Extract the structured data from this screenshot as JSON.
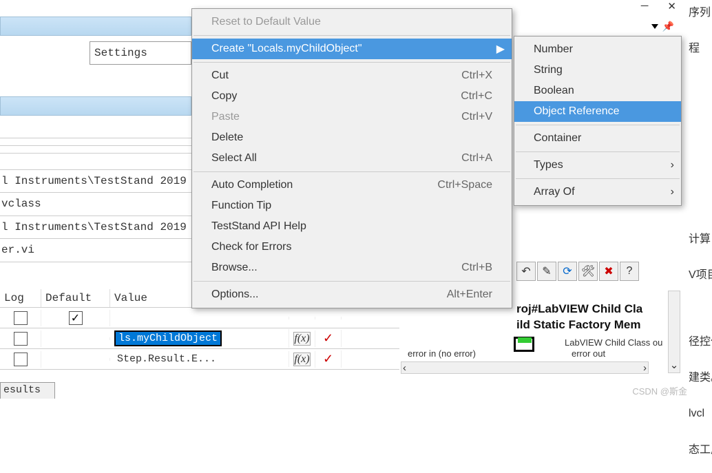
{
  "topbar": {
    "settings": "Settings"
  },
  "bg": {
    "row1": "l Instruments\\TestStand 2019",
    "row2": "vclass",
    "row3": "l Instruments\\TestStand 2019",
    "row4": "er.vi"
  },
  "table": {
    "hdr_log": "Log",
    "hdr_default": "Default",
    "hdr_value": "Value",
    "val1": "ls.myChildObject",
    "val2": "Step.Result.E...",
    "fx": "f(x)"
  },
  "results_tab": "esults",
  "menu": {
    "reset": "Reset to Default Value",
    "create": "Create \"Locals.myChildObject\"",
    "cut": "Cut",
    "cut_key": "Ctrl+X",
    "copy": "Copy",
    "copy_key": "Ctrl+C",
    "paste": "Paste",
    "paste_key": "Ctrl+V",
    "delete": "Delete",
    "selectall": "Select All",
    "selectall_key": "Ctrl+A",
    "auto": "Auto Completion",
    "auto_key": "Ctrl+Space",
    "ftip": "Function Tip",
    "api": "TestStand API Help",
    "check": "Check for Errors",
    "browse": "Browse...",
    "browse_key": "Ctrl+B",
    "options": "Options...",
    "options_key": "Alt+Enter"
  },
  "submenu": {
    "number": "Number",
    "string": "String",
    "boolean": "Boolean",
    "objref": "Object Reference",
    "container": "Container",
    "types": "Types",
    "arrayof": "Array Of"
  },
  "cn": {
    "t1": "序列",
    "t2": "程",
    "t3": "计算",
    "t4": "V项目",
    "t5": "径控作",
    "t6": "建类。",
    "t7": "lvcl",
    "t8": "态工厂"
  },
  "right": {
    "proj1": "roj#LabVIEW Child Cla",
    "proj2": "ild Static Factory Mem",
    "lv_out": "LabVIEW Child Class ou",
    "err_in": "error in (no error)",
    "err_out": "error out"
  },
  "watermark": "CSDN @斯金"
}
